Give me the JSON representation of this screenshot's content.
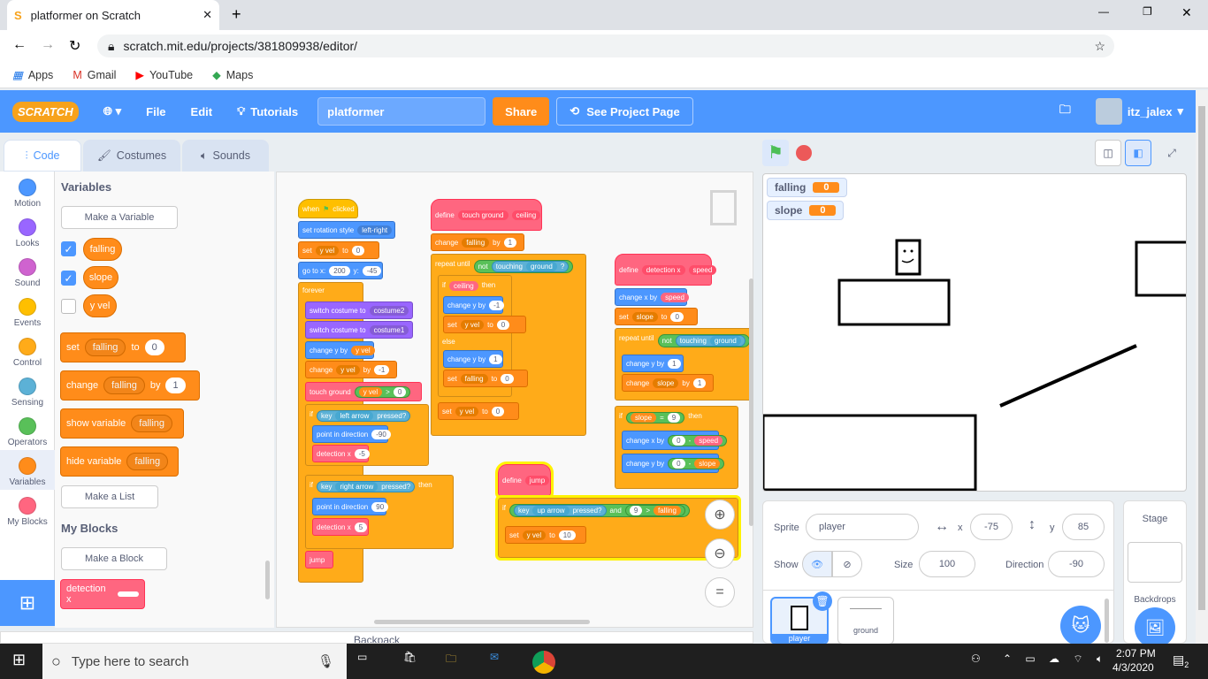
{
  "browser": {
    "tab_title": "platformer on Scratch",
    "url": "scratch.mit.edu/projects/381809938/editor/",
    "bookmarks": [
      "Apps",
      "Gmail",
      "YouTube",
      "Maps"
    ]
  },
  "menu": {
    "logo": "SCRATCH",
    "file": "File",
    "edit": "Edit",
    "tutorials": "Tutorials",
    "project_title": "platformer",
    "share": "Share",
    "see_project": "See Project Page",
    "username": "itz_jalex"
  },
  "tabs": {
    "code": "Code",
    "costumes": "Costumes",
    "sounds": "Sounds"
  },
  "categories": [
    {
      "label": "Motion",
      "color": "#4c97ff"
    },
    {
      "label": "Looks",
      "color": "#9966ff"
    },
    {
      "label": "Sound",
      "color": "#cf63cf"
    },
    {
      "label": "Events",
      "color": "#ffbf00"
    },
    {
      "label": "Control",
      "color": "#ffab19"
    },
    {
      "label": "Sensing",
      "color": "#5cb1d6"
    },
    {
      "label": "Operators",
      "color": "#59c059"
    },
    {
      "label": "Variables",
      "color": "#ff8c1a"
    },
    {
      "label": "My Blocks",
      "color": "#ff6680"
    }
  ],
  "palette": {
    "variables_title": "Variables",
    "make_variable": "Make a Variable",
    "vars": [
      "falling",
      "slope",
      "y vel"
    ],
    "set_label": "set",
    "set_var": "falling",
    "to_label": "to",
    "set_val": "0",
    "change_label": "change",
    "change_var": "falling",
    "by_label": "by",
    "change_val": "1",
    "show_label": "show variable",
    "show_var": "falling",
    "hide_label": "hide variable",
    "hide_var": "falling",
    "make_list": "Make a List",
    "myblocks_title": "My Blocks",
    "make_block": "Make a Block",
    "detection_block": "detection x"
  },
  "scripts": {
    "s1": [
      "when",
      "clicked",
      "set rotation style",
      "left-right",
      "set",
      "y vel",
      "to",
      "0",
      "go to x:",
      "200",
      "y:",
      "-45",
      "forever",
      "switch costume to",
      "costume2",
      "switch costume to",
      "costume1",
      "change y by",
      "y vel",
      "change",
      "y vel",
      "by",
      "-1",
      "touch ground",
      "y vel",
      ">",
      "0",
      "if",
      "key",
      "left arrow",
      "pressed?",
      "then",
      "point in direction",
      "-90",
      "detection x",
      "-5",
      "if",
      "key",
      "right arrow",
      "pressed?",
      "then",
      "point in direction",
      "90",
      "detection x",
      "5",
      "jump"
    ],
    "s2": [
      "define",
      "touch ground",
      "ceiling",
      "change",
      "falling",
      "by",
      "1",
      "repeat until",
      "not",
      "touching",
      "ground",
      "?",
      "if",
      "ceiling",
      "then",
      "change y by",
      "-1",
      "set",
      "y vel",
      "to",
      "0",
      "else",
      "change y by",
      "1",
      "set",
      "falling",
      "to",
      "0",
      "set",
      "y vel",
      "to",
      "0"
    ],
    "s3": [
      "define",
      "detection x",
      "speed",
      "change x by",
      "speed",
      "set",
      "slope",
      "to",
      "0",
      "repeat until",
      "not",
      "touching",
      "ground",
      "change y by",
      "1",
      "change",
      "slope",
      "by",
      "1",
      "if",
      "slope",
      "=",
      "9",
      "then",
      "change x by",
      "0",
      "-",
      "speed",
      "change y by",
      "0",
      "-",
      "slope"
    ],
    "s4": [
      "define",
      "jump",
      "if",
      "key",
      "up arrow",
      "pressed?",
      "and",
      "9",
      ">",
      "falling",
      "set",
      "y vel",
      "to",
      "10"
    ]
  },
  "monitors": [
    {
      "name": "falling",
      "value": "0"
    },
    {
      "name": "slope",
      "value": "0"
    }
  ],
  "sprite": {
    "sprite_label": "Sprite",
    "name": "player",
    "x_label": "x",
    "x": "-75",
    "y_label": "y",
    "y": "85",
    "show_label": "Show",
    "size_label": "Size",
    "size": "100",
    "direction_label": "Direction",
    "direction": "-90",
    "sprites": [
      "player",
      "ground"
    ]
  },
  "stage_pane": {
    "title": "Stage",
    "backdrops": "Backdrops"
  },
  "backpack": "Backpack",
  "taskbar": {
    "search_placeholder": "Type here to search",
    "time": "2:07 PM",
    "date": "4/3/2020",
    "notifications": "2"
  }
}
